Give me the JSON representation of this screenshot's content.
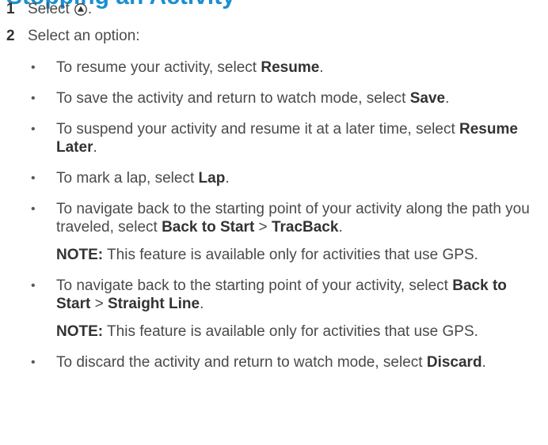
{
  "section": {
    "heading": "Stopping an Activity",
    "heading_color": "#1a8fd0"
  },
  "steps": [
    {
      "number": "1",
      "text": "Select",
      "icon": "up-triangle-button-icon",
      "suffix": "."
    },
    {
      "number": "2",
      "text": "Select an option:"
    }
  ],
  "options": [
    {
      "prefix": "To resume your activity, select ",
      "bold1": "Resume",
      "suffix": "."
    },
    {
      "prefix": "To save the activity and return to watch mode, select ",
      "bold1": "Save",
      "suffix": "."
    },
    {
      "prefix": "To suspend your activity and resume it at a later time, select ",
      "bold1": "Resume Later",
      "suffix": "."
    },
    {
      "prefix": "To mark a lap, select ",
      "bold1": "Lap",
      "suffix": "."
    },
    {
      "prefix": "To navigate back to the starting point of your activity along the path you traveled, select ",
      "bold1": "Back to Start",
      "mid": " > ",
      "bold2": "TracBack",
      "suffix": ".",
      "note_label": "NOTE:",
      "note_text": " This feature is available only for activities that use GPS."
    },
    {
      "prefix": "To navigate back to the starting point of your activity, select ",
      "bold1": "Back to Start",
      "mid": " > ",
      "bold2": "Straight Line",
      "suffix": ".",
      "note_label": "NOTE:",
      "note_text": " This feature is available only for activities that use GPS."
    },
    {
      "prefix": "To discard the activity and return to watch mode, select ",
      "bold1": "Discard",
      "suffix": "."
    }
  ],
  "bullet_glyph": "•"
}
